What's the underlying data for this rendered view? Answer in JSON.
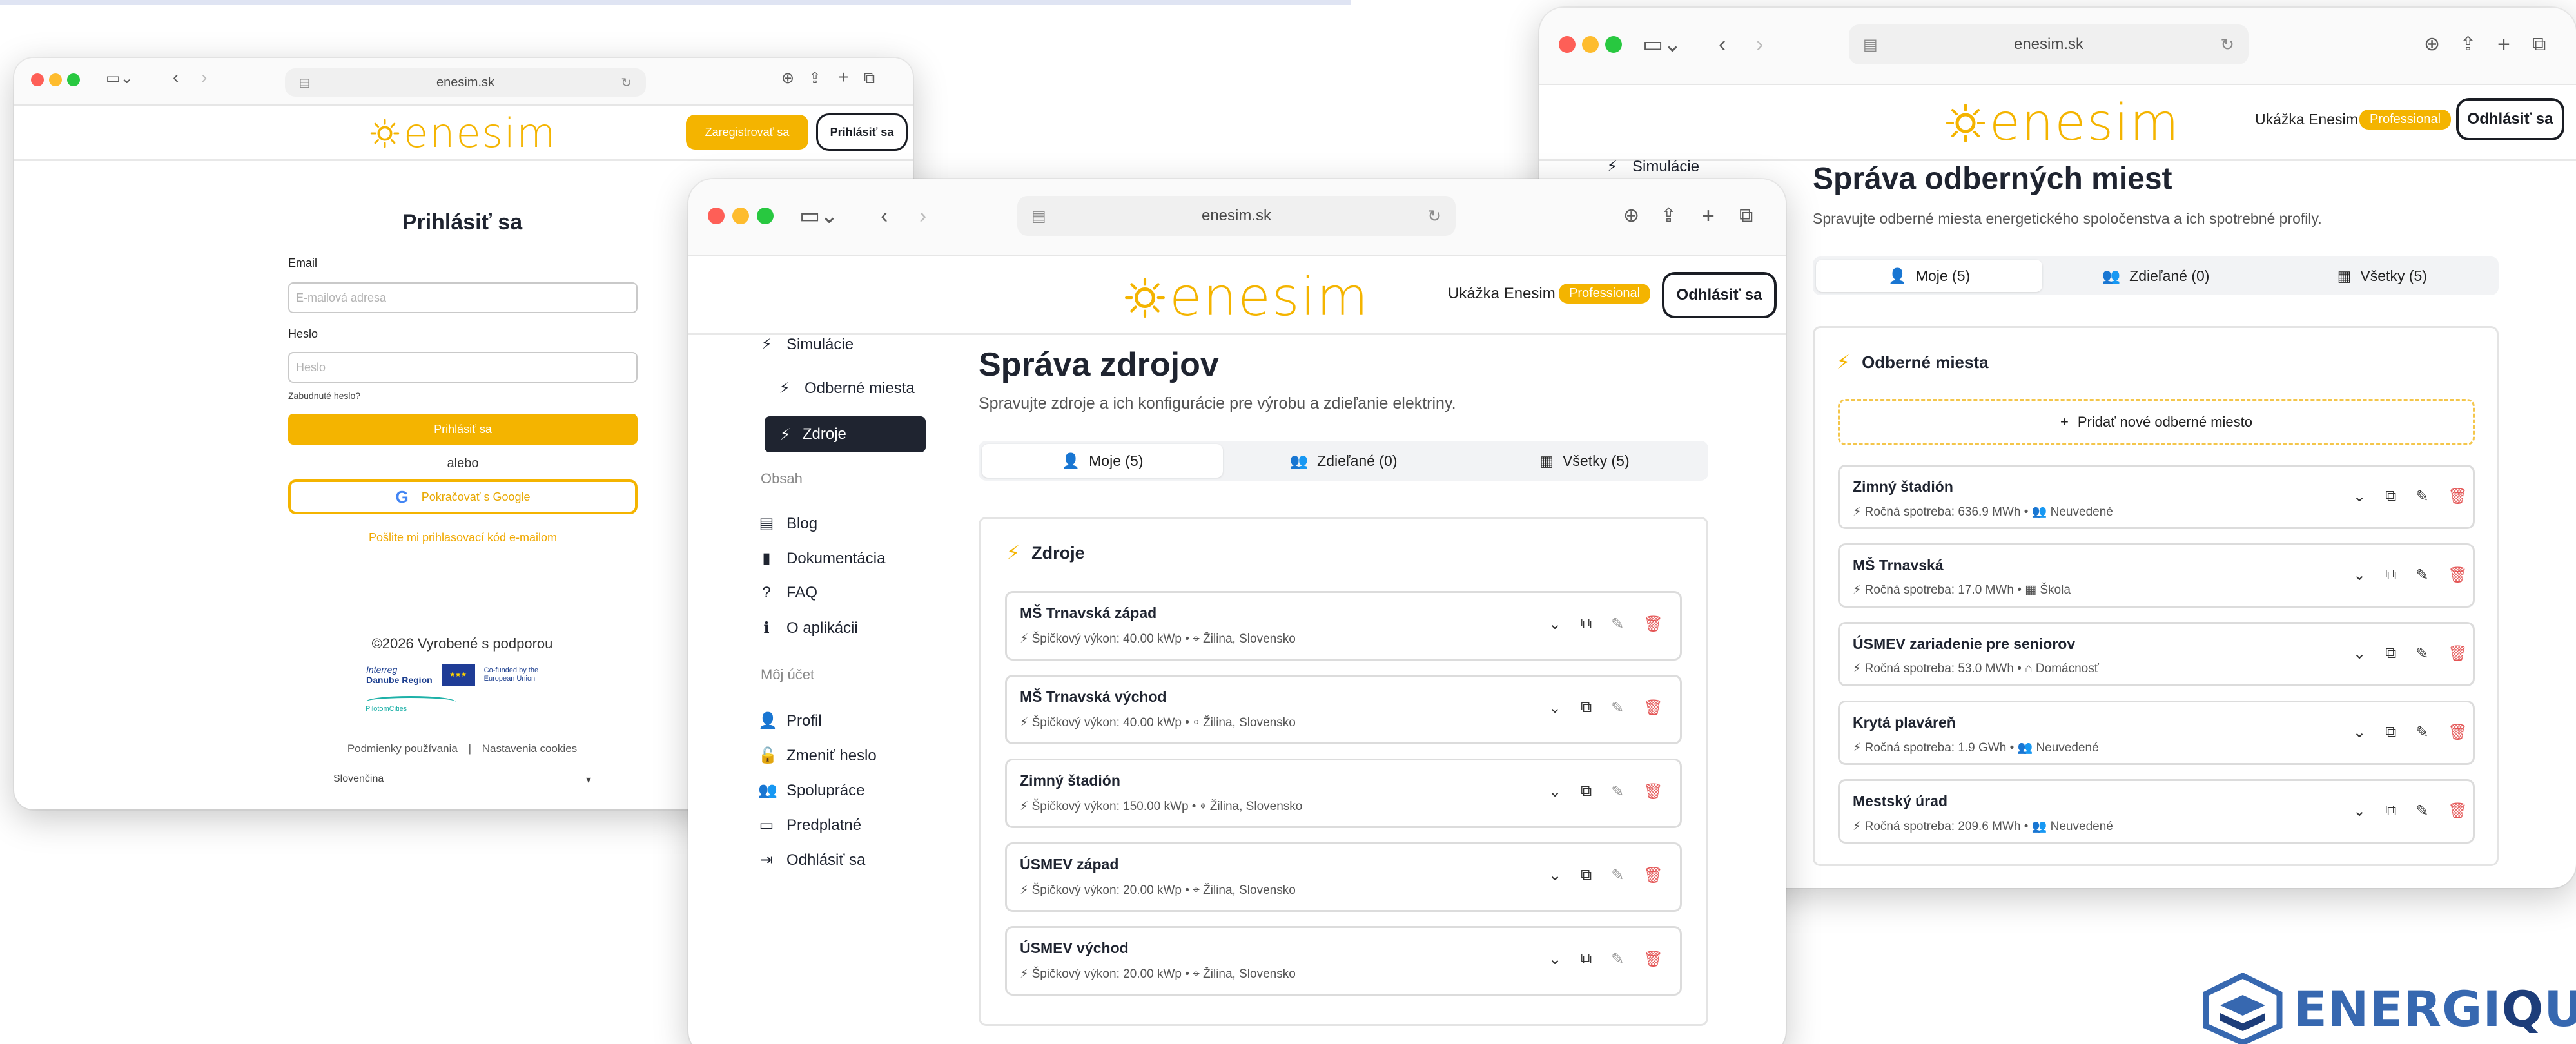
{
  "browser": {
    "url": "enesim.sk"
  },
  "brand": {
    "logo_text": "enesim",
    "accent": "#f4b400",
    "dark": "#1f2430",
    "danger": "#e45656",
    "corner_brand": "ENERGIQUBE",
    "corner_brand_part1": "ENERGI",
    "corner_brand_part2": "Q",
    "corner_brand_part3": "UBE"
  },
  "login": {
    "register_button": "Zaregistrovať sa",
    "login_button": "Prihlásiť sa",
    "title": "Prihlásiť sa",
    "email_label": "Email",
    "email_placeholder": "E-mailová adresa",
    "password_label": "Heslo",
    "password_placeholder": "Heslo",
    "forgot_password": "Zabudnuté heslo?",
    "submit": "Prihlásiť sa",
    "or": "alebo",
    "google": "Pokračovať s Google",
    "email_code_link": "Pošlite mi prihlasovací kód e-mailom",
    "footer": "©2026 Vyrobené s podporou",
    "interreg": "Interreg",
    "danube": "Danube Region",
    "eu_cofunded": "Co-funded by the European Union",
    "pilot_cities": "PilotomCities",
    "terms": "Podmienky používania",
    "separator": "|",
    "cookies": "Nastavenia cookies",
    "language": "Slovenčina"
  },
  "header": {
    "user_name": "Ukážka Enesim",
    "plan_badge": "Professional",
    "logout_button": "Odhlásiť sa"
  },
  "sidebar": {
    "simulations": "Simulácie",
    "consumption_points": "Odberné miesta",
    "sources": "Zdroje",
    "content_section": "Obsah",
    "blog": "Blog",
    "docs": "Dokumentácia",
    "faq": "FAQ",
    "about": "O aplikácii",
    "account_section": "Môj účet",
    "profile": "Profil",
    "change_password": "Zmeniť heslo",
    "collaboration": "Spolupráce",
    "subscription": "Predplatné",
    "logout": "Odhlásiť sa"
  },
  "sources_page": {
    "title": "Správa zdrojov",
    "subtitle": "Spravujte zdroje a ich konfigurácie pre výrobu a zdieľanie elektriny.",
    "tabs": [
      {
        "label": "Moje (5)"
      },
      {
        "label": "Zdieľané (0)"
      },
      {
        "label": "Všetky (5)"
      }
    ],
    "panel_title": "Zdroje",
    "items": [
      {
        "name": "MŠ Trnavská západ",
        "power": "Špičkový výkon: 40.00 kWp",
        "location": "Žilina, Slovensko"
      },
      {
        "name": "MŠ Trnavská východ",
        "power": "Špičkový výkon: 40.00 kWp",
        "location": "Žilina, Slovensko"
      },
      {
        "name": "Zimný štadión",
        "power": "Špičkový výkon: 150.00 kWp",
        "location": "Žilina, Slovensko"
      },
      {
        "name": "ÚSMEV západ",
        "power": "Špičkový výkon: 20.00 kWp",
        "location": "Žilina, Slovensko"
      },
      {
        "name": "ÚSMEV východ",
        "power": "Špičkový výkon: 20.00 kWp",
        "location": "Žilina, Slovensko"
      }
    ]
  },
  "points_page": {
    "title": "Správa odberných miest",
    "subtitle": "Spravujte odberné miesta energetického spoločenstva a ich spotrebné profily.",
    "tabs": [
      {
        "label": "Moje (5)"
      },
      {
        "label": "Zdieľané (0)"
      },
      {
        "label": "Všetky (5)"
      }
    ],
    "panel_title": "Odberné miesta",
    "add_button": "Pridať nové odberné miesto",
    "items": [
      {
        "name": "Zimný štadión",
        "consumption": "Ročná spotreba: 636.9 MWh",
        "type": "Neuvedené",
        "type_icon": "users-icon"
      },
      {
        "name": "MŠ Trnavská",
        "consumption": "Ročná spotreba: 17.0 MWh",
        "type": "Škola",
        "type_icon": "school-icon"
      },
      {
        "name": "ÚSMEV zariadenie pre seniorov",
        "consumption": "Ročná spotreba: 53.0 MWh",
        "type": "Domácnosť",
        "type_icon": "home-icon"
      },
      {
        "name": "Krytá plaváreň",
        "consumption": "Ročná spotreba: 1.9 GWh",
        "type": "Neuvedené",
        "type_icon": "users-icon"
      },
      {
        "name": "Mestský úrad",
        "consumption": "Ročná spotreba: 209.6 MWh",
        "type": "Neuvedené",
        "type_icon": "users-icon"
      }
    ]
  }
}
